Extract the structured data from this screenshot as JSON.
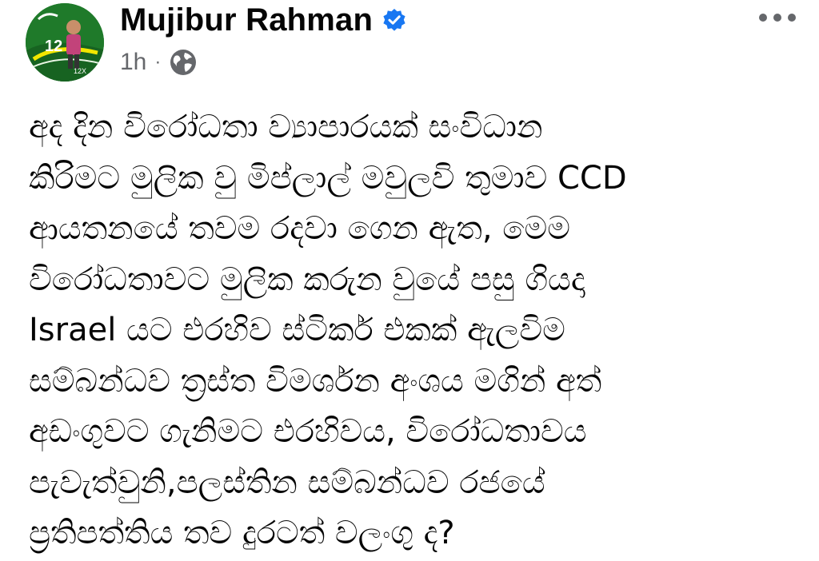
{
  "post": {
    "author": "Mujibur Rahman",
    "verified": true,
    "time": "1h",
    "separator": "·",
    "audience_icon": "globe-icon",
    "more_icon": "more-options-icon",
    "avatar_text": {
      "number": "12",
      "badge": "12X"
    },
    "lines": [
      "අද දින විරෝධතා ව්‍යාපාරයක් සංවිධාන",
      "කිරිමට මුලික වු මිප්ලාල් මවුලවි තුමාව CCD",
      "ආයතනයේ තවම රදවා ගෙන ඇත, මෙම",
      "විරෝධතාවට මුලික කරුන වුයේ පසු ගියදා",
      "Israel යට එරහිව ස්ටිකර් එකක් ඇලවිම",
      "සම්බන්ධව ත්‍රස්ත විමර්ශන අංශය මගින් අත්",
      "අඩංගුවට ගැනිමට එරහිවය, විරෝධතාවය",
      "පැවැත්වුනි,පලස්තින සම්බන්ධව රජයේ",
      "ප්‍රතිපත්තිය තව දුරටත් වලංගු ද?"
    ]
  },
  "colors": {
    "verified_blue": "#1877f2",
    "secondary_text": "#65676b",
    "avatar_green": "#1f7a2a",
    "avatar_yellow": "#f2e600"
  }
}
